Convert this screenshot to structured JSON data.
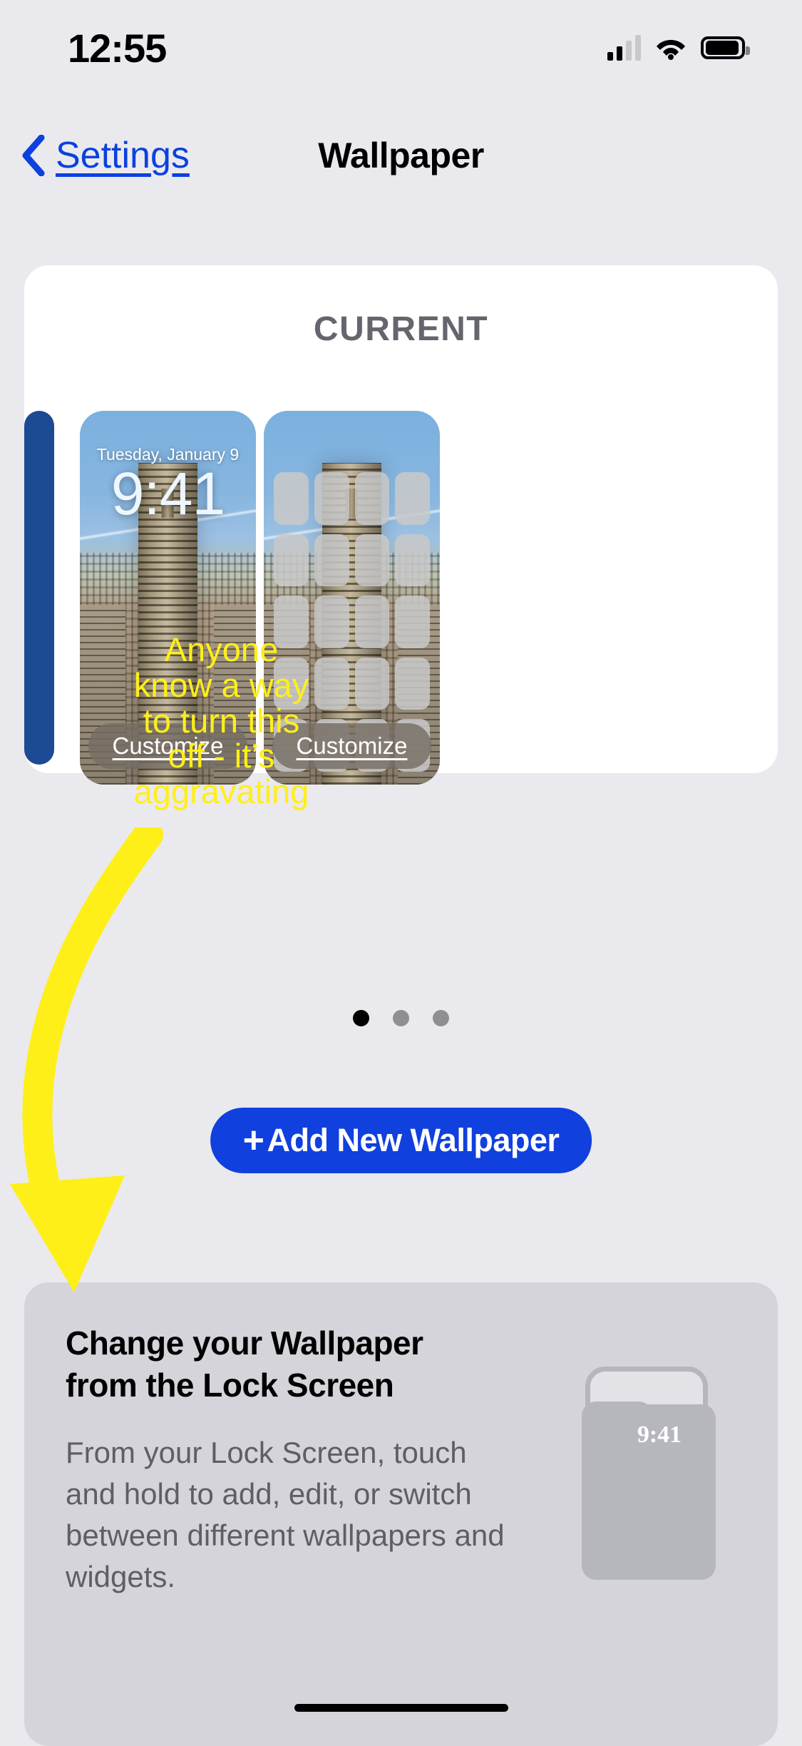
{
  "status_bar": {
    "time": "12:55",
    "signal_icon": "cellular-bars-icon",
    "wifi_icon": "wifi-icon",
    "battery_icon": "battery-full-icon",
    "signal_bars_filled": 2,
    "signal_bars_total": 4
  },
  "nav": {
    "back_label": "Settings",
    "back_icon": "chevron-left-icon",
    "title": "Wallpaper",
    "accent_color": "#0b41dd"
  },
  "current_card": {
    "heading": "CURRENT",
    "lock_preview": {
      "date": "Tuesday, January 9",
      "time": "9:41",
      "customize_label": "Customize"
    },
    "home_preview": {
      "customize_label": "Customize",
      "app_icon_count": 20
    }
  },
  "pagination": {
    "total": 3,
    "active_index": 0
  },
  "add_button": {
    "plus": "+",
    "label": "Add New Wallpaper",
    "color": "#1040dd"
  },
  "info_card": {
    "title": "Change your Wallpaper from the Lock Screen",
    "body": "From your Lock Screen, touch and hold to add, edit, or switch between different wallpapers and widgets.",
    "phone_time": "9:41",
    "background_color": "#d4d4da"
  },
  "annotation": {
    "text": "Anyone know a way to turn this off - it’s aggravating",
    "color": "#ffef19",
    "arrow_icon": "curved-arrow-icon"
  },
  "page_background": "#eae9ee"
}
